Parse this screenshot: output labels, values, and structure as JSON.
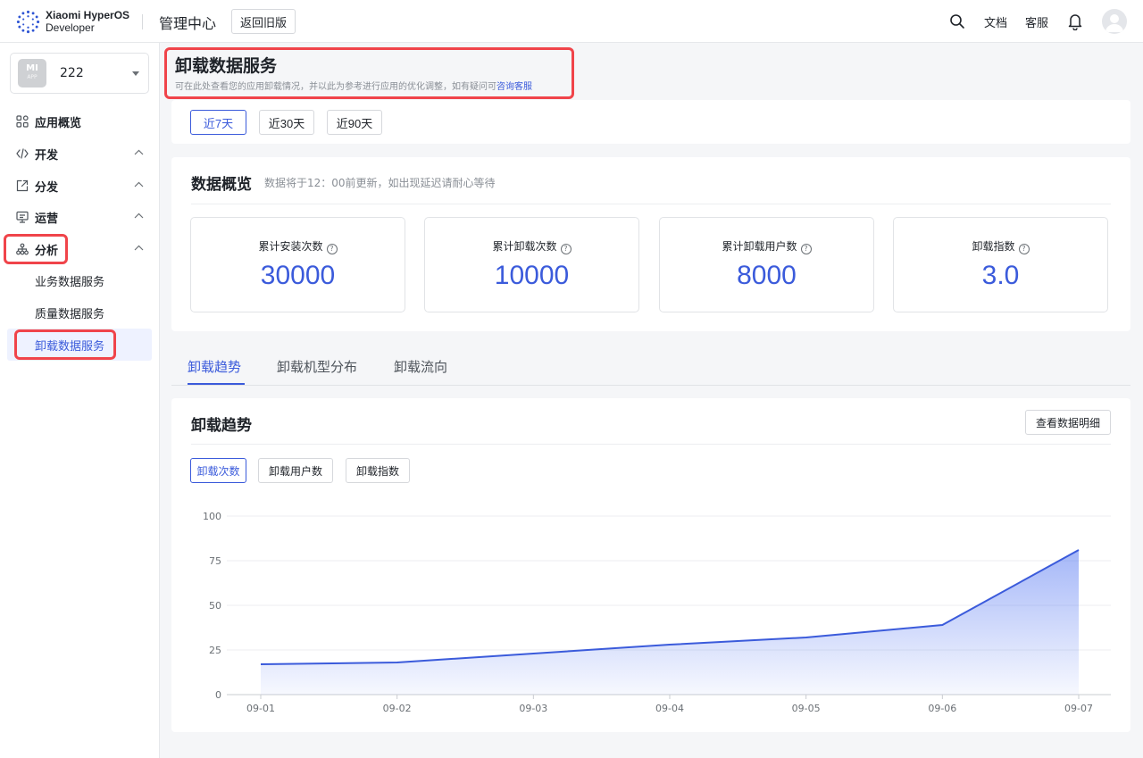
{
  "header": {
    "brand_line1": "Xiaomi HyperOS",
    "brand_line2": "Developer",
    "title": "管理中心",
    "back_label": "返回旧版",
    "docs_label": "文档",
    "support_label": "客服",
    "icons": [
      "search-icon",
      "bell-icon",
      "avatar-icon"
    ]
  },
  "sidebar": {
    "app_name": "222",
    "app_icon_text": "MI",
    "app_icon_sub": "APP",
    "items": [
      {
        "label": "应用概览",
        "icon": "grid-icon",
        "chevron": false
      },
      {
        "label": "开发",
        "icon": "code-icon",
        "chevron": true
      },
      {
        "label": "分发",
        "icon": "share-icon",
        "chevron": true
      },
      {
        "label": "运营",
        "icon": "monitor-icon",
        "chevron": true
      },
      {
        "label": "分析",
        "icon": "hierarchy-icon",
        "chevron": true
      }
    ],
    "sub_items": [
      {
        "label": "业务数据服务",
        "active": false
      },
      {
        "label": "质量数据服务",
        "active": false
      },
      {
        "label": "卸载数据服务",
        "active": true
      }
    ]
  },
  "page": {
    "title": "卸载数据服务",
    "subtitle": "可在此处查看您的应用卸载情况，并以此为参考进行应用的优化调整，如有疑问可",
    "subtitle_link": "咨询客服"
  },
  "date_range": {
    "options": [
      "近7天",
      "近30天",
      "近90天"
    ],
    "selected": "近7天"
  },
  "overview": {
    "title": "数据概览",
    "note": "数据将于12：00前更新，如出现延迟请耐心等待",
    "stats": [
      {
        "label": "累计安装次数",
        "value": "30000"
      },
      {
        "label": "累计卸载次数",
        "value": "10000"
      },
      {
        "label": "累计卸载用户数",
        "value": "8000"
      },
      {
        "label": "卸载指数",
        "value": "3.0"
      }
    ]
  },
  "tabs": {
    "items": [
      "卸载趋势",
      "卸载机型分布",
      "卸载流向"
    ],
    "selected": "卸载趋势"
  },
  "trend": {
    "title": "卸载趋势",
    "detail_label": "查看数据明细",
    "metrics": [
      "卸载次数",
      "卸载用户数",
      "卸载指数"
    ],
    "selected_metric": "卸载次数"
  },
  "colors": {
    "accent": "#3b5bdb",
    "highlight": "#f0444a"
  },
  "chart_data": {
    "type": "area",
    "x": [
      "09-01",
      "09-02",
      "09-03",
      "09-04",
      "09-05",
      "09-06",
      "09-07"
    ],
    "series": [
      {
        "values": [
          17,
          18,
          23,
          28,
          32,
          39,
          81
        ]
      }
    ],
    "yticks": [
      0,
      25,
      50,
      75,
      100
    ],
    "ylim": [
      0,
      100
    ],
    "grid": true
  }
}
